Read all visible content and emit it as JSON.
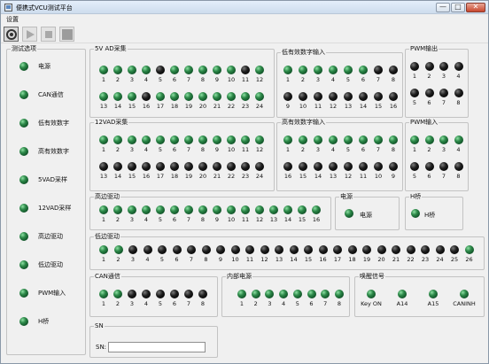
{
  "window": {
    "title": "便携式VCU测试平台",
    "minimize_glyph": "—",
    "maximize_glyph": "□",
    "close_glyph": "✕"
  },
  "menu": {
    "settings": "设置"
  },
  "toolbar": [
    {
      "name": "settings-icon",
      "icon": "gear"
    },
    {
      "name": "run-icon",
      "icon": "play"
    },
    {
      "name": "stop-icon",
      "icon": "stop"
    },
    {
      "name": "pause-icon",
      "icon": "square"
    }
  ],
  "sidebar": {
    "title": "测试选项",
    "items": [
      "电源",
      "CAN通信",
      "低有效数字",
      "高有效数字",
      "5VAD采样",
      "12VAD采样",
      "高边驱动",
      "低边驱动",
      "PWM输入",
      "H桥"
    ]
  },
  "colors": {
    "led_on": "#1e7a3a",
    "led_off": "#111111"
  },
  "groups": [
    {
      "id": "ad5v",
      "title": "5V AD采集",
      "rows": [
        {
          "labels": [
            "1",
            "2",
            "3",
            "4",
            "5",
            "6",
            "7",
            "8",
            "9",
            "10",
            "11",
            "12"
          ],
          "states": [
            "g",
            "g",
            "g",
            "g",
            "k",
            "g",
            "g",
            "g",
            "g",
            "g",
            "k",
            "g"
          ]
        },
        {
          "labels": [
            "13",
            "14",
            "15",
            "16",
            "17",
            "18",
            "19",
            "20",
            "21",
            "22",
            "23",
            "24"
          ],
          "states": [
            "g",
            "g",
            "g",
            "k",
            "g",
            "g",
            "g",
            "g",
            "g",
            "g",
            "g",
            "g"
          ]
        }
      ]
    },
    {
      "id": "di_low",
      "title": "低有效数字输入",
      "rows": [
        {
          "labels": [
            "1",
            "2",
            "3",
            "4",
            "5",
            "6",
            "7",
            "8"
          ],
          "states": [
            "g",
            "g",
            "g",
            "g",
            "g",
            "g",
            "k",
            "k"
          ]
        },
        {
          "labels": [
            "9",
            "10",
            "11",
            "12",
            "13",
            "14",
            "15",
            "16"
          ],
          "states": [
            "k",
            "k",
            "k",
            "k",
            "k",
            "k",
            "k",
            "k"
          ]
        }
      ]
    },
    {
      "id": "pwm_out",
      "title": "PWM输出",
      "rows": [
        {
          "labels": [
            "1",
            "2",
            "3",
            "4"
          ],
          "states": [
            "k",
            "k",
            "k",
            "k"
          ]
        },
        {
          "labels": [
            "5",
            "6",
            "7",
            "8"
          ],
          "states": [
            "k",
            "k",
            "k",
            "k"
          ]
        }
      ]
    },
    {
      "id": "ad12v",
      "title": "12VAD采集",
      "rows": [
        {
          "labels": [
            "1",
            "2",
            "3",
            "4",
            "5",
            "6",
            "7",
            "8",
            "9",
            "10",
            "11",
            "12"
          ],
          "states": [
            "g",
            "g",
            "g",
            "g",
            "g",
            "g",
            "g",
            "g",
            "g",
            "g",
            "g",
            "g"
          ]
        },
        {
          "labels": [
            "13",
            "14",
            "15",
            "16",
            "17",
            "18",
            "19",
            "20",
            "21",
            "22",
            "23",
            "24"
          ],
          "states": [
            "k",
            "k",
            "k",
            "k",
            "k",
            "k",
            "k",
            "k",
            "k",
            "k",
            "k",
            "k"
          ]
        }
      ]
    },
    {
      "id": "di_high",
      "title": "高有效数字输入",
      "rows": [
        {
          "labels": [
            "1",
            "2",
            "3",
            "4",
            "5",
            "6",
            "7",
            "8"
          ],
          "states": [
            "g",
            "g",
            "g",
            "g",
            "g",
            "g",
            "g",
            "g"
          ]
        },
        {
          "labels": [
            "16",
            "15",
            "14",
            "13",
            "12",
            "11",
            "10",
            "9"
          ],
          "states": [
            "k",
            "k",
            "k",
            "k",
            "k",
            "k",
            "k",
            "k"
          ]
        }
      ]
    },
    {
      "id": "pwm_in",
      "title": "PWM输入",
      "rows": [
        {
          "labels": [
            "1",
            "2",
            "3",
            "4"
          ],
          "states": [
            "g",
            "g",
            "g",
            "g"
          ]
        },
        {
          "labels": [
            "5",
            "6",
            "7",
            "8"
          ],
          "states": [
            "k",
            "k",
            "k",
            "k"
          ]
        }
      ]
    },
    {
      "id": "hs_drive",
      "title": "高边驱动",
      "rows": [
        {
          "labels": [
            "1",
            "2",
            "3",
            "4",
            "5",
            "6",
            "7",
            "8",
            "9",
            "10",
            "11",
            "12",
            "13",
            "14",
            "15",
            "16"
          ],
          "states": [
            "g",
            "g",
            "g",
            "g",
            "g",
            "g",
            "g",
            "g",
            "g",
            "g",
            "g",
            "g",
            "g",
            "g",
            "g",
            "g"
          ]
        }
      ]
    },
    {
      "id": "ls_drive",
      "title": "低边驱动",
      "rows": [
        {
          "labels": [
            "1",
            "2",
            "3",
            "4",
            "5",
            "6",
            "7",
            "8",
            "9",
            "10",
            "11",
            "12",
            "13",
            "14",
            "15",
            "16",
            "17",
            "18",
            "19",
            "20",
            "21",
            "22",
            "23",
            "24",
            "25",
            "26"
          ],
          "states": [
            "g",
            "g",
            "k",
            "k",
            "k",
            "k",
            "k",
            "k",
            "k",
            "k",
            "k",
            "k",
            "k",
            "k",
            "k",
            "k",
            "k",
            "k",
            "k",
            "k",
            "k",
            "k",
            "k",
            "k",
            "k",
            "g"
          ]
        }
      ]
    },
    {
      "id": "can_comm",
      "title": "CAN通信",
      "rows": [
        {
          "labels": [
            "1",
            "2",
            "3",
            "4",
            "5",
            "6",
            "7",
            "8"
          ],
          "states": [
            "g",
            "g",
            "k",
            "k",
            "k",
            "k",
            "k",
            "k"
          ]
        }
      ]
    },
    {
      "id": "int_power",
      "title": "内部电源",
      "rows": [
        {
          "labels": [
            "1",
            "2",
            "3",
            "4",
            "5",
            "6",
            "7",
            "8"
          ],
          "states": [
            "g",
            "g",
            "g",
            "g",
            "g",
            "g",
            "g",
            "g"
          ]
        }
      ]
    },
    {
      "id": "wake",
      "title": "唤醒信号",
      "rows": [
        {
          "labels": [
            "Key ON",
            "A14",
            "A15",
            "CANINH"
          ],
          "states": [
            "g",
            "g",
            "g",
            "g"
          ]
        }
      ]
    }
  ],
  "power": {
    "title": "电源",
    "label": "电源"
  },
  "hbridge": {
    "title": "H桥",
    "label": "H桥"
  },
  "sn": {
    "title": "SN",
    "label": "SN:",
    "value": ""
  }
}
